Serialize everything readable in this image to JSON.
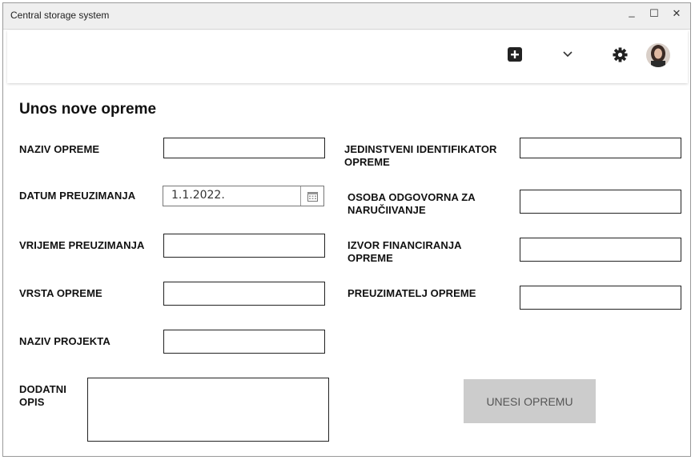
{
  "window": {
    "title": "Central storage system",
    "minimize": "_",
    "maximize": "☐",
    "close": "✕"
  },
  "toolbar": {
    "icons": [
      "add-icon",
      "chevron-down-icon",
      "gear-icon",
      "avatar"
    ]
  },
  "form": {
    "heading": "Unos nove opreme",
    "naziv_opreme": {
      "label": "NAZIV OPREME",
      "value": ""
    },
    "datum_preuzimanja": {
      "label": "DATUM PREUZIMANJA",
      "value": "1.1.2022."
    },
    "vrijeme_preuzimanja": {
      "label": "VRIJEME PREUZIMANJA",
      "value": ""
    },
    "vrsta_opreme": {
      "label": "VRSTA OPREME",
      "value": ""
    },
    "naziv_projekta": {
      "label": "NAZIV PROJEKTA",
      "value": ""
    },
    "dodatni_opis": {
      "label_line1": "DODATNI",
      "label_line2": "OPIS",
      "value": ""
    },
    "jedinstveni_identifikator": {
      "label_line1": "JEDINSTVENI IDENTIFIKATOR",
      "label_line2": "OPREME",
      "value": ""
    },
    "osoba_odgovorna": {
      "label_line1": "OSOBA ODGOVORNA ZA",
      "label_line2": "NARUČIIVANJE",
      "value": ""
    },
    "izvor_financiranja": {
      "label_line1": "IZVOR FINANCIRANJA",
      "label_line2": "OPREME",
      "value": ""
    },
    "preuzimatelj": {
      "label": "PREUZIMATELJ OPREME",
      "value": ""
    },
    "submit_label": "UNESI OPREMU"
  }
}
